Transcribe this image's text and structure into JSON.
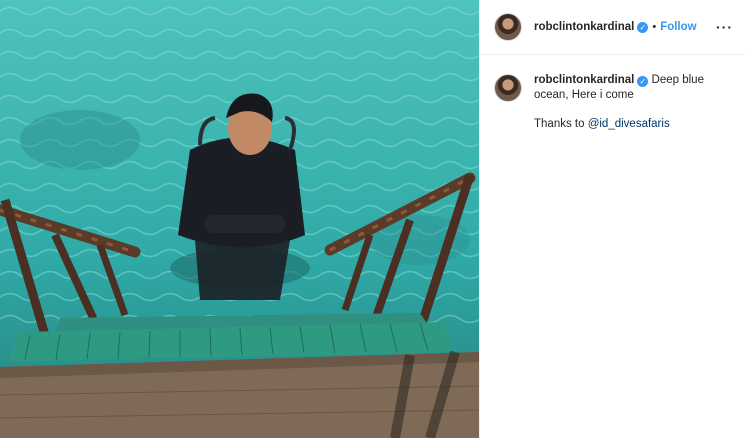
{
  "post": {
    "username": "robclintonkardinal",
    "verified_icon": "verified-badge-icon",
    "separator": "•",
    "follow_label": "Follow",
    "more_icon": "more-options-icon",
    "more_label": "···"
  },
  "caption": {
    "username": "robclintonkardinal",
    "text": "Deep blue ocean, Here i come",
    "thanks_prefix": "Thanks to ",
    "mention": "@id_divesafaris"
  },
  "colors": {
    "accent": "#3897f0",
    "mention": "#003569",
    "water": "#3fb3b0"
  }
}
